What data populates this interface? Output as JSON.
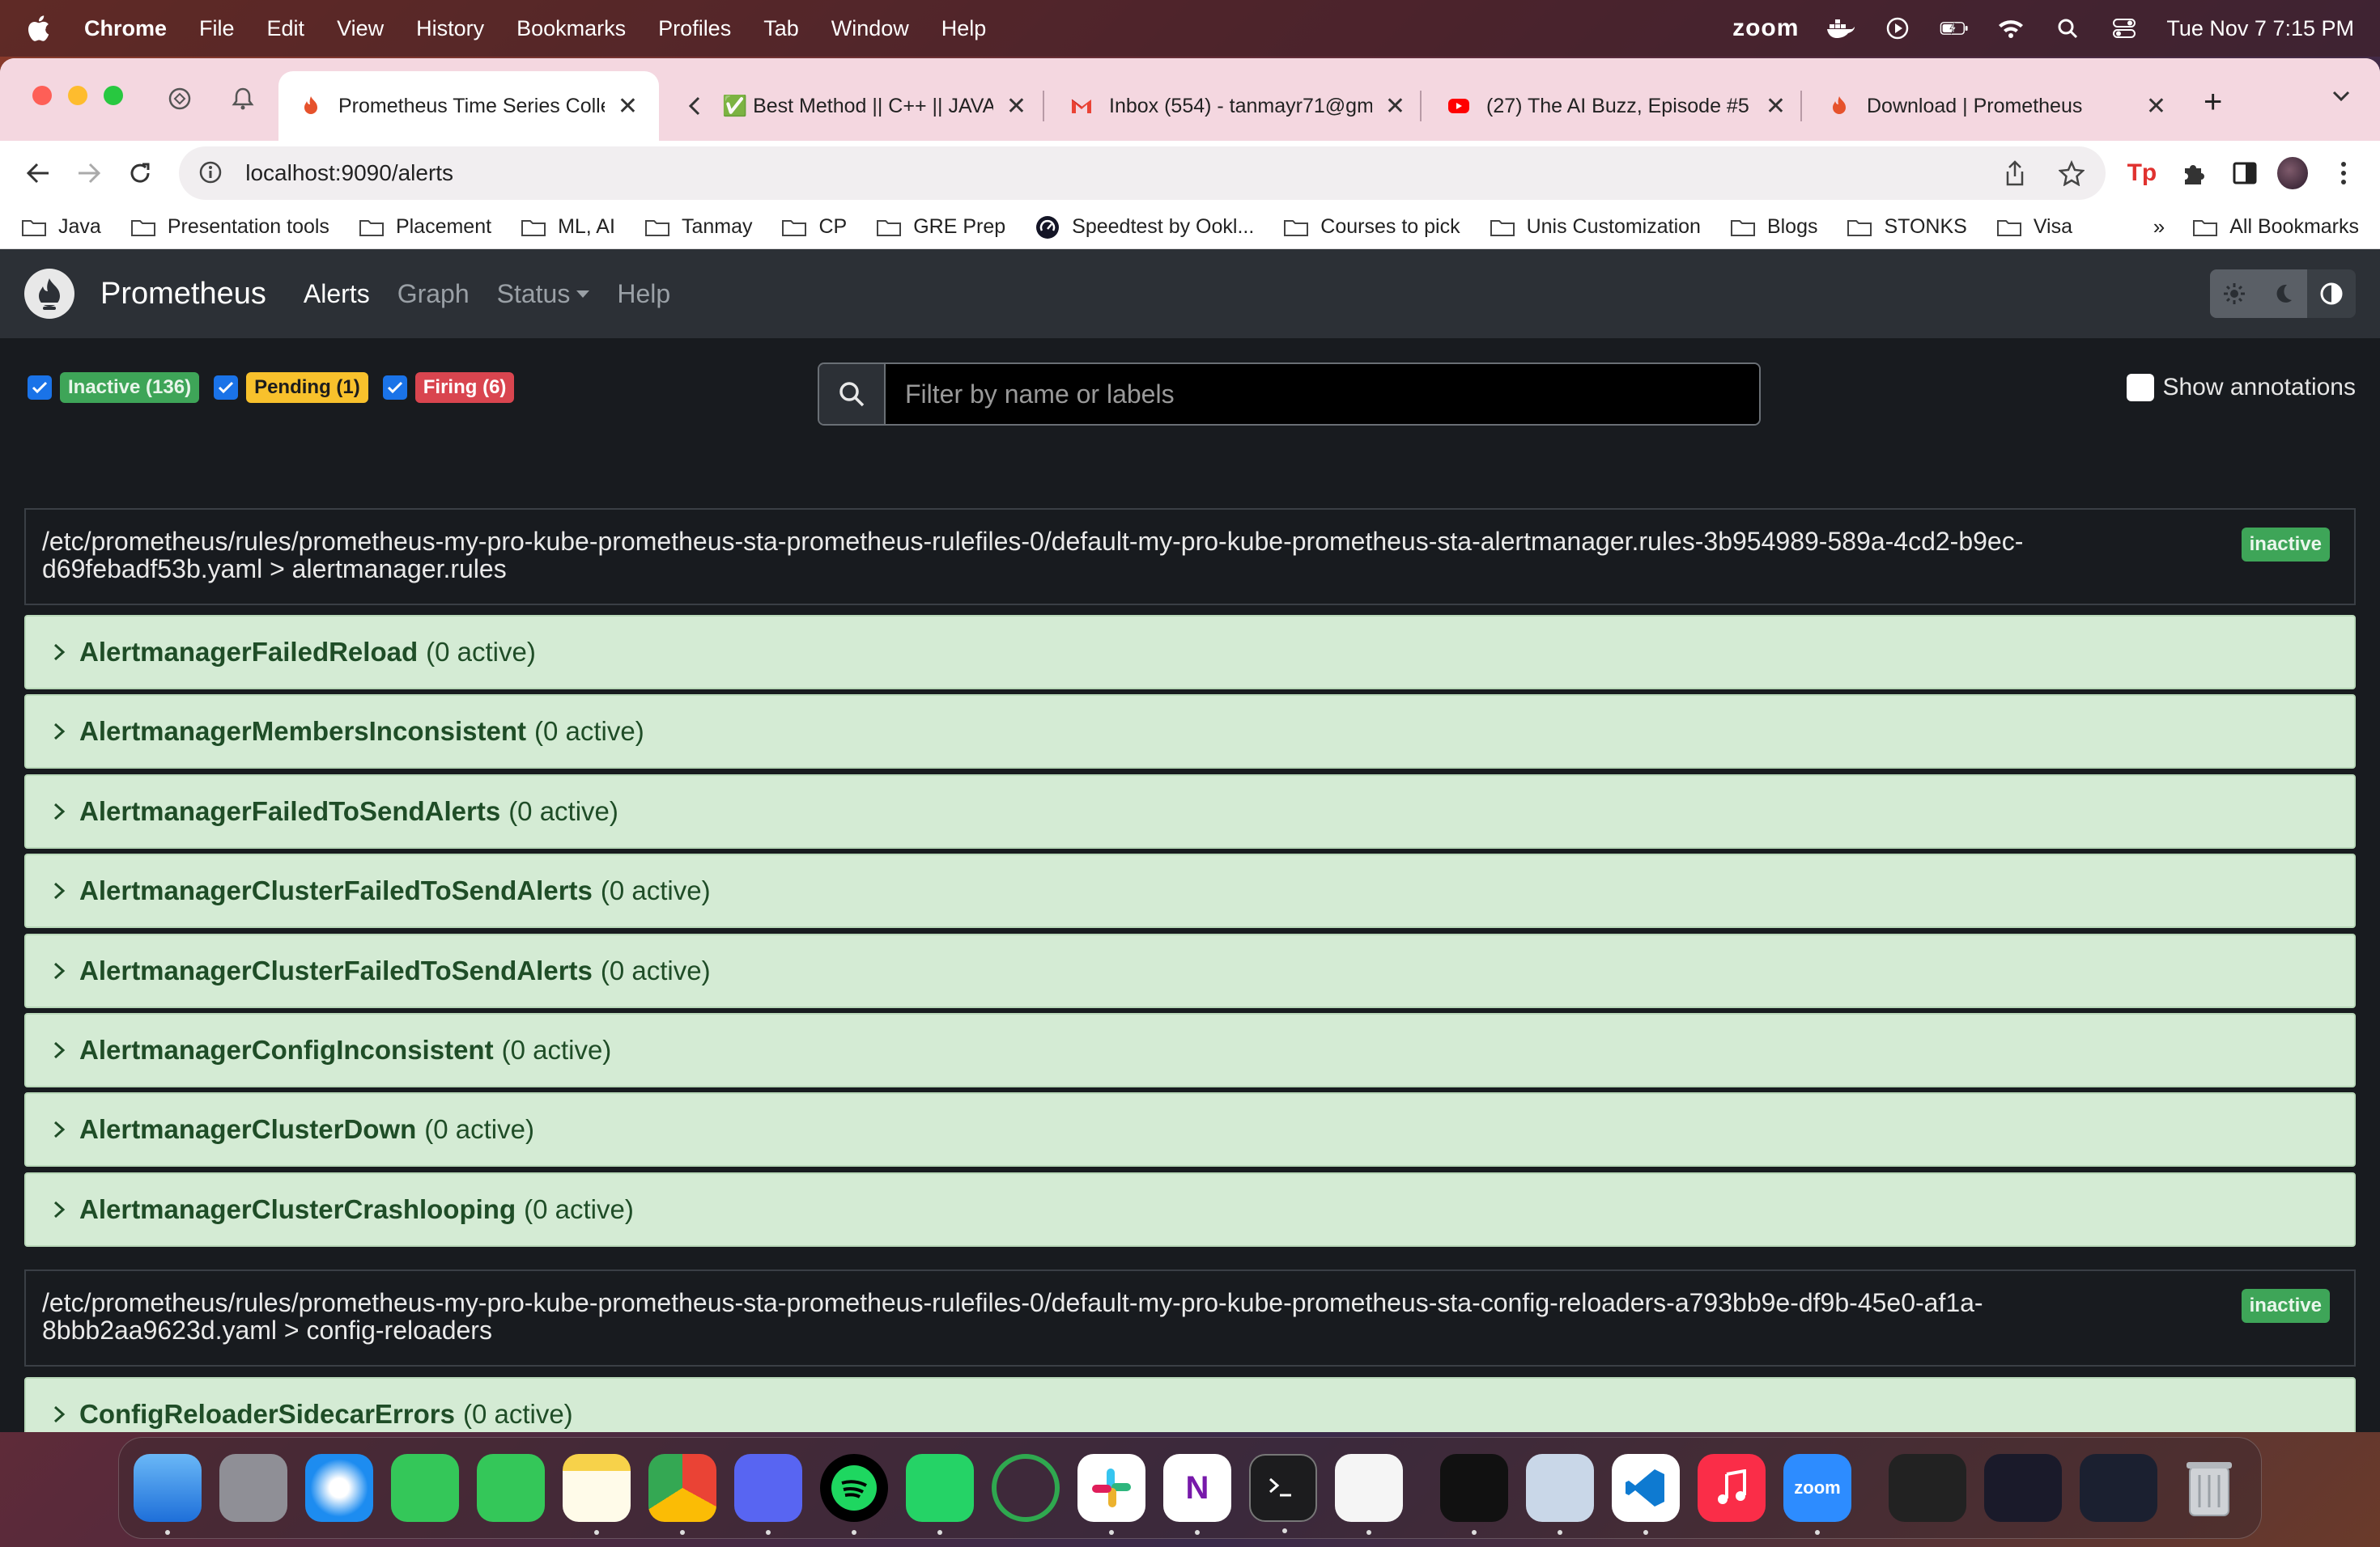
{
  "menubar": {
    "app": "Chrome",
    "items": [
      "File",
      "Edit",
      "View",
      "History",
      "Bookmarks",
      "Profiles",
      "Tab",
      "Window",
      "Help"
    ],
    "zoom": "zoom",
    "datetime": "Tue Nov 7  7:15 PM"
  },
  "tabs": [
    {
      "title": "Prometheus Time Series Colle",
      "close": "✕"
    },
    {
      "title": "✅ Best Method || C++ || JAVA",
      "close": "✕"
    },
    {
      "title": "Inbox (554) - tanmayr71@gm",
      "close": "✕"
    },
    {
      "title": "(27) The AI Buzz, Episode #5",
      "close": "✕"
    },
    {
      "title": "Download | Prometheus",
      "close": "✕"
    }
  ],
  "newtab": "+",
  "omnibox": {
    "url": "localhost:9090/alerts"
  },
  "bookmarks": {
    "items": [
      "Java",
      "Presentation tools",
      "Placement",
      "ML, AI",
      "Tanmay",
      "CP",
      "GRE Prep",
      "Speedtest by Ookl...",
      "Courses to pick",
      "Unis Customization",
      "Blogs",
      "STONKS",
      "Visa"
    ],
    "more": "»",
    "all": "All Bookmarks"
  },
  "prom": {
    "brand": "Prometheus",
    "nav": {
      "alerts": "Alerts",
      "graph": "Graph",
      "status": "Status",
      "help": "Help"
    },
    "filters": {
      "inactive": "Inactive (136)",
      "pending": "Pending (1)",
      "firing": "Firing (6)"
    },
    "search_placeholder": "Filter by name or labels",
    "show_annotations": "Show annotations",
    "groups": [
      {
        "path": "/etc/prometheus/rules/prometheus-my-pro-kube-prometheus-sta-prometheus-rulefiles-0/default-my-pro-kube-prometheus-sta-alertmanager.rules-3b954989-589a-4cd2-b9ec-d69febadf53b.yaml > alertmanager.rules",
        "state": "inactive",
        "rules": [
          {
            "name": "AlertmanagerFailedReload",
            "count": "(0 active)"
          },
          {
            "name": "AlertmanagerMembersInconsistent",
            "count": "(0 active)"
          },
          {
            "name": "AlertmanagerFailedToSendAlerts",
            "count": "(0 active)"
          },
          {
            "name": "AlertmanagerClusterFailedToSendAlerts",
            "count": "(0 active)"
          },
          {
            "name": "AlertmanagerClusterFailedToSendAlerts",
            "count": "(0 active)"
          },
          {
            "name": "AlertmanagerConfigInconsistent",
            "count": "(0 active)"
          },
          {
            "name": "AlertmanagerClusterDown",
            "count": "(0 active)"
          },
          {
            "name": "AlertmanagerClusterCrashlooping",
            "count": "(0 active)"
          }
        ]
      },
      {
        "path": "/etc/prometheus/rules/prometheus-my-pro-kube-prometheus-sta-prometheus-rulefiles-0/default-my-pro-kube-prometheus-sta-config-reloaders-a793bb9e-df9b-45e0-af1a-8bbb2aa9623d.yaml > config-reloaders",
        "state": "inactive",
        "rules": [
          {
            "name": "ConfigReloaderSidecarErrors",
            "count": "(0 active)"
          }
        ]
      }
    ]
  },
  "dock": {
    "apps": [
      "finder",
      "launchpad",
      "safari",
      "messages",
      "facetime",
      "notes",
      "chrome",
      "discord",
      "spotify",
      "whatsapp",
      "loading",
      "slack",
      "onenote",
      "terminal",
      "textedit",
      "screens",
      "preview",
      "vscode",
      "music",
      "zoom"
    ],
    "zoom_label": "zoom"
  },
  "colors": {
    "rule_bg": "#d4ebd4",
    "rule_text": "#1f4d27",
    "inactive": "#3ea558",
    "pending": "#f8c12c",
    "firing": "#d9454f"
  }
}
